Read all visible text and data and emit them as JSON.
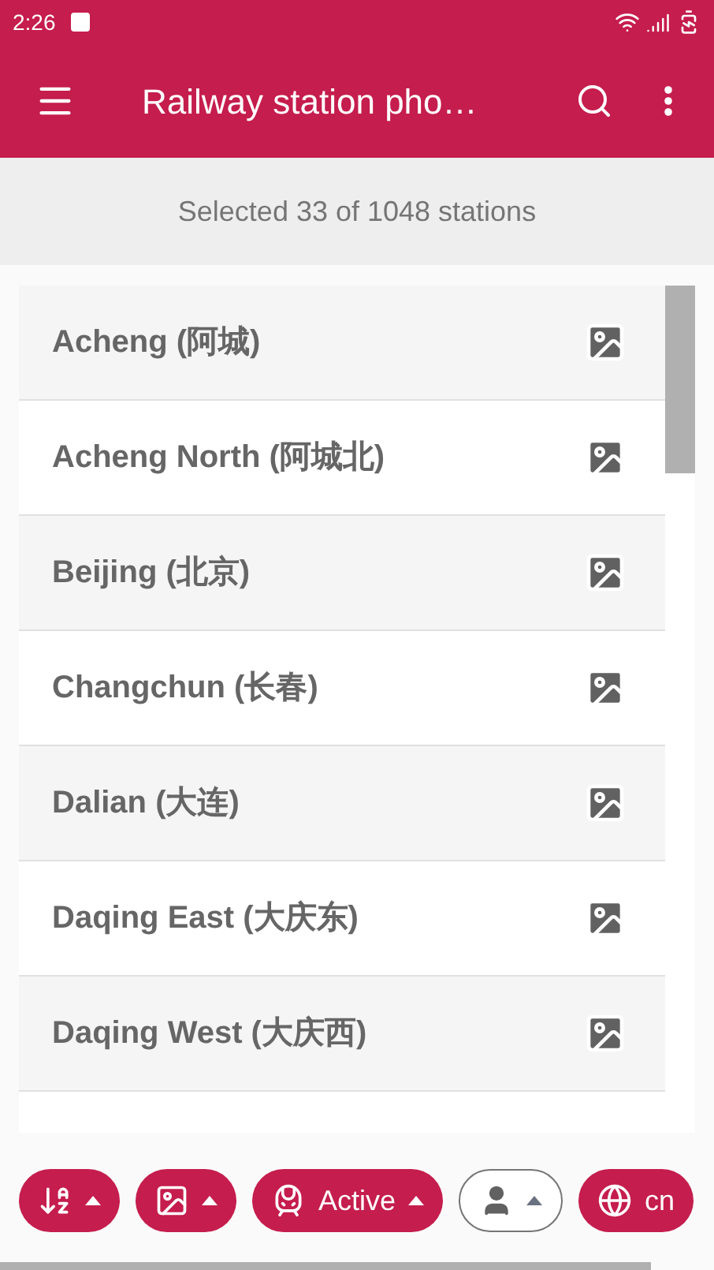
{
  "status_bar": {
    "time": "2:26"
  },
  "app_bar": {
    "title": "Railway station pho…"
  },
  "summary": "Selected 33 of 1048 stations",
  "stations": [
    {
      "name": "Acheng (阿城)"
    },
    {
      "name": "Acheng North (阿城北)"
    },
    {
      "name": "Beijing (北京)"
    },
    {
      "name": "Changchun (长春)"
    },
    {
      "name": "Dalian (大连)"
    },
    {
      "name": "Daqing East (大庆东)"
    },
    {
      "name": "Daqing West (大庆西)"
    }
  ],
  "filter_chips": [
    {
      "kind": "sort",
      "selected": true
    },
    {
      "kind": "photo",
      "selected": true
    },
    {
      "kind": "station",
      "label": "Active",
      "selected": true
    },
    {
      "kind": "person",
      "selected": false
    },
    {
      "kind": "country",
      "label": "cn",
      "selected": true
    }
  ]
}
